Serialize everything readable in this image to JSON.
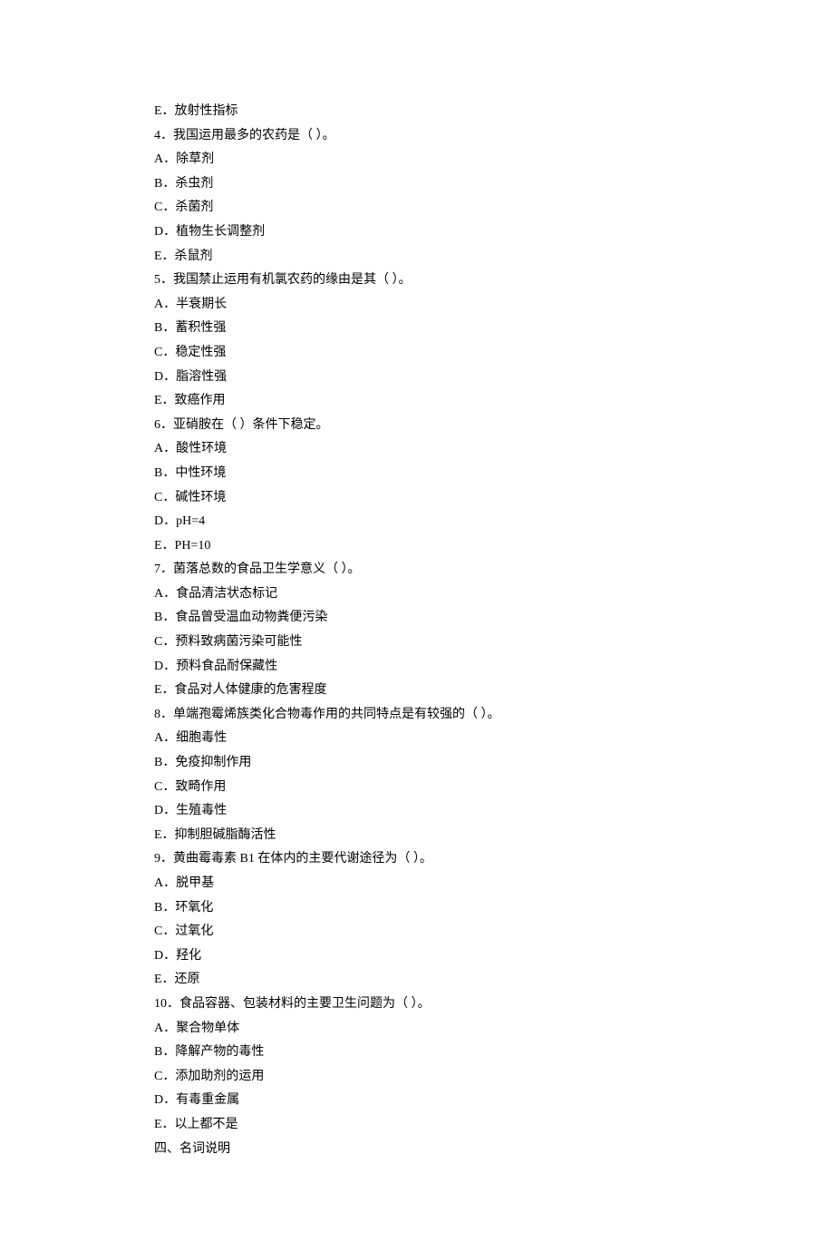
{
  "lines": [
    "E．放射性指标",
    "4．我国运用最多的农药是（ ）。",
    "A．除草剂",
    "B．杀虫剂",
    "C．杀菌剂",
    "D．植物生长调整剂",
    "E．杀鼠剂",
    "5．我国禁止运用有机氯农药的缘由是其（ ）。",
    "A．半衰期长",
    "B．蓄积性强",
    "C．稳定性强",
    "D．脂溶性强",
    "E．致癌作用",
    "6．亚硝胺在（  ）条件下稳定。",
    "A．酸性环境",
    "B．中性环境",
    "C．碱性环境",
    "D．pH=4",
    "E．PH=10",
    "7．菌落总数的食品卫生学意义（ ）。",
    "A．食品清洁状态标记",
    "B．食品曾受温血动物粪便污染",
    "C．预料致病菌污染可能性",
    "D．预料食品耐保藏性",
    "E．食品对人体健康的危害程度",
    "8．单端孢霉烯族类化合物毒作用的共同特点是有较强的（ ）。",
    "A．细胞毒性",
    "B．免疫抑制作用",
    "C．致畸作用",
    "D．生殖毒性",
    "E．抑制胆碱脂酶活性",
    "9．黄曲霉毒素 B1 在体内的主要代谢途径为（ ）。",
    "A．脱甲基",
    "B．环氧化",
    "C．过氧化",
    "D．羟化",
    "E．还原",
    "10．食品容器、包装材料的主要卫生问题为（ ）。",
    "A．聚合物单体",
    "B．降解产物的毒性",
    "C．添加助剂的运用",
    "D．有毒重金属",
    "E．以上都不是",
    "四、名词说明"
  ]
}
